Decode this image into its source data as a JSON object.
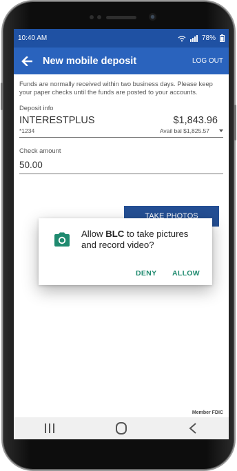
{
  "status_bar": {
    "time": "10:40 AM",
    "battery": "78%",
    "icons": [
      "wifi-icon",
      "signal-icon",
      "battery-icon"
    ]
  },
  "app_bar": {
    "title": "New mobile deposit",
    "logout_label": "LOG OUT"
  },
  "notice": "Funds are normally received within two business days. Please keep your paper checks until the funds are posted to your accounts.",
  "deposit_info": {
    "label": "Deposit info",
    "account_name": "INTERESTPLUS",
    "account_number": "*1234",
    "balance": "$1,843.96",
    "available": "Avail bal $1,825.57"
  },
  "check_amount": {
    "label": "Check amount",
    "value": "50.00"
  },
  "take_photos_label": "TAKE PHOTOS",
  "dialog": {
    "prefix": "Allow ",
    "app_name": "BLC",
    "suffix": " to take pictures and record video?",
    "deny_label": "DENY",
    "allow_label": "ALLOW",
    "icon": "camera-icon"
  },
  "footer": {
    "member_fdic": "Member FDIC"
  },
  "nav_bar": {
    "icons": [
      "recent-apps-icon",
      "home-icon",
      "back-nav-icon"
    ]
  },
  "colors": {
    "status_bar": "#1f51a3",
    "app_bar": "#2a63bd",
    "button": "#244f94",
    "dialog_accent": "#1f8a6f"
  }
}
